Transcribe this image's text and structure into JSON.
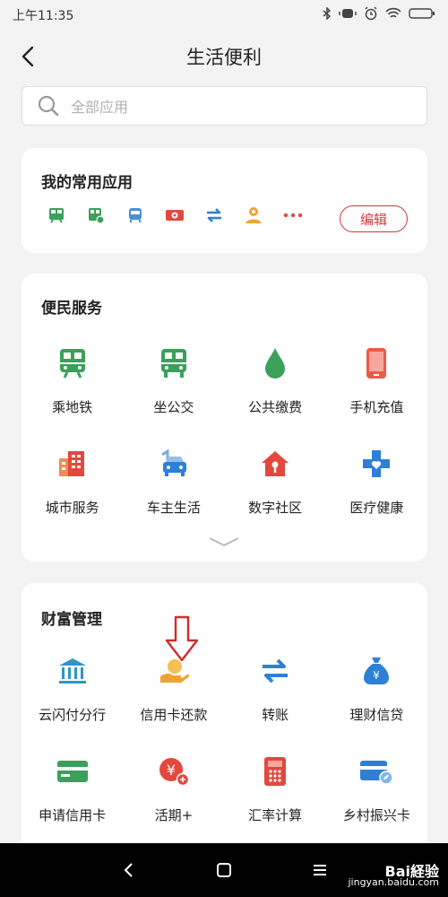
{
  "status": {
    "time": "上午11:35"
  },
  "header": {
    "title": "生活便利"
  },
  "search": {
    "placeholder": "全部应用"
  },
  "favorites": {
    "title": "我的常用应用",
    "icons": [
      "subway-icon",
      "bus-card-icon",
      "bus-icon",
      "cash-icon",
      "transfer-icon",
      "user-coin-icon",
      "more-icon"
    ],
    "edit_label": "编辑"
  },
  "services": {
    "title": "便民服务",
    "items": [
      {
        "label": "乘地铁",
        "icon": "subway-icon"
      },
      {
        "label": "坐公交",
        "icon": "bus-icon"
      },
      {
        "label": "公共缴费",
        "icon": "water-drop-icon"
      },
      {
        "label": "手机充值",
        "icon": "phone-icon"
      },
      {
        "label": "城市服务",
        "icon": "city-building-icon"
      },
      {
        "label": "车主生活",
        "icon": "car-icon"
      },
      {
        "label": "数字社区",
        "icon": "house-icon"
      },
      {
        "label": "医疗健康",
        "icon": "medical-cross-icon"
      }
    ]
  },
  "wealth": {
    "title": "财富管理",
    "items": [
      {
        "label": "云闪付分行",
        "icon": "bank-icon"
      },
      {
        "label": "信用卡还款",
        "icon": "hand-coin-icon"
      },
      {
        "label": "转账",
        "icon": "transfer-icon"
      },
      {
        "label": "理财信贷",
        "icon": "money-bag-icon"
      },
      {
        "label": "申请信用卡",
        "icon": "credit-card-icon"
      },
      {
        "label": "活期+",
        "icon": "yuan-plus-icon"
      },
      {
        "label": "汇率计算",
        "icon": "calculator-icon"
      },
      {
        "label": "乡村振兴卡",
        "icon": "card-leaf-icon"
      }
    ]
  },
  "watermark": {
    "brand": "Bai経验",
    "domain": "jingyan.baidu.com"
  },
  "colors": {
    "accent": "#d9363e",
    "green": "#3aa05a",
    "orange": "#f0a330",
    "blue": "#2e7fd6",
    "red": "#e3483f"
  }
}
